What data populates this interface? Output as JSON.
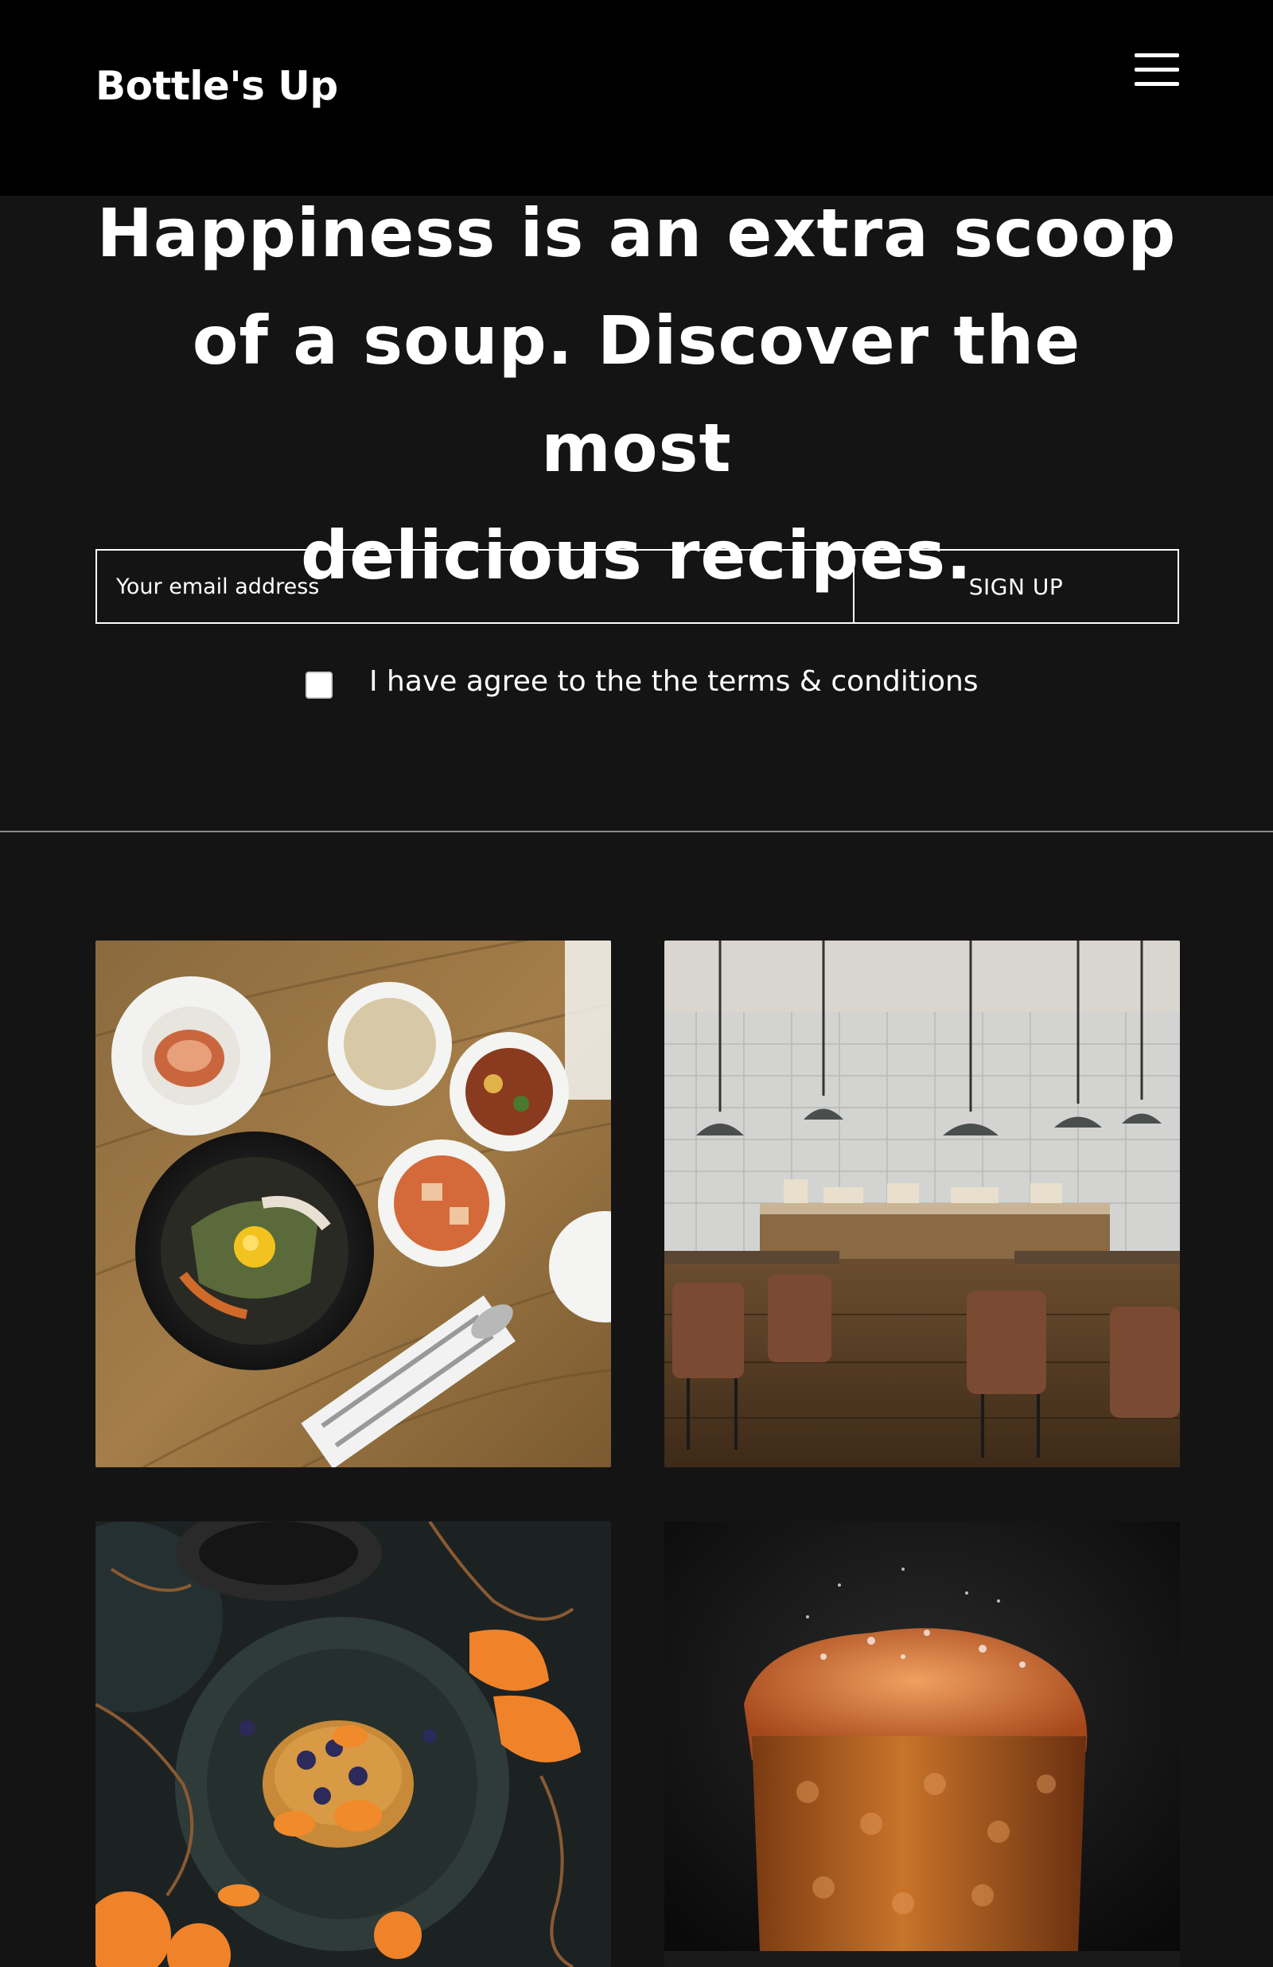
{
  "header": {
    "logo_text": "Bottle's Up",
    "menu_icon": "hamburger-menu-icon"
  },
  "hero": {
    "title_line_1": "Happiness is an extra scoop",
    "title_line_2": "of a soup. Discover the most",
    "title_line_3": "delicious recipes."
  },
  "signup": {
    "email_placeholder": "Your email address",
    "email_value": "",
    "button_label": "SIGN UP"
  },
  "terms": {
    "checked": false,
    "label": "I have agree to the the terms & conditions"
  },
  "gallery": {
    "images": [
      {
        "subject": "korean-bibimbap-table-photo"
      },
      {
        "subject": "restaurant-interior-photo"
      },
      {
        "subject": "pancakes-with-oranges-photo"
      },
      {
        "subject": "sugared-panettone-cake-photo"
      }
    ]
  },
  "colors": {
    "header_background": "#000000",
    "page_background": "#141414",
    "text": "#ffffff",
    "divider": "#8a8a8a"
  }
}
